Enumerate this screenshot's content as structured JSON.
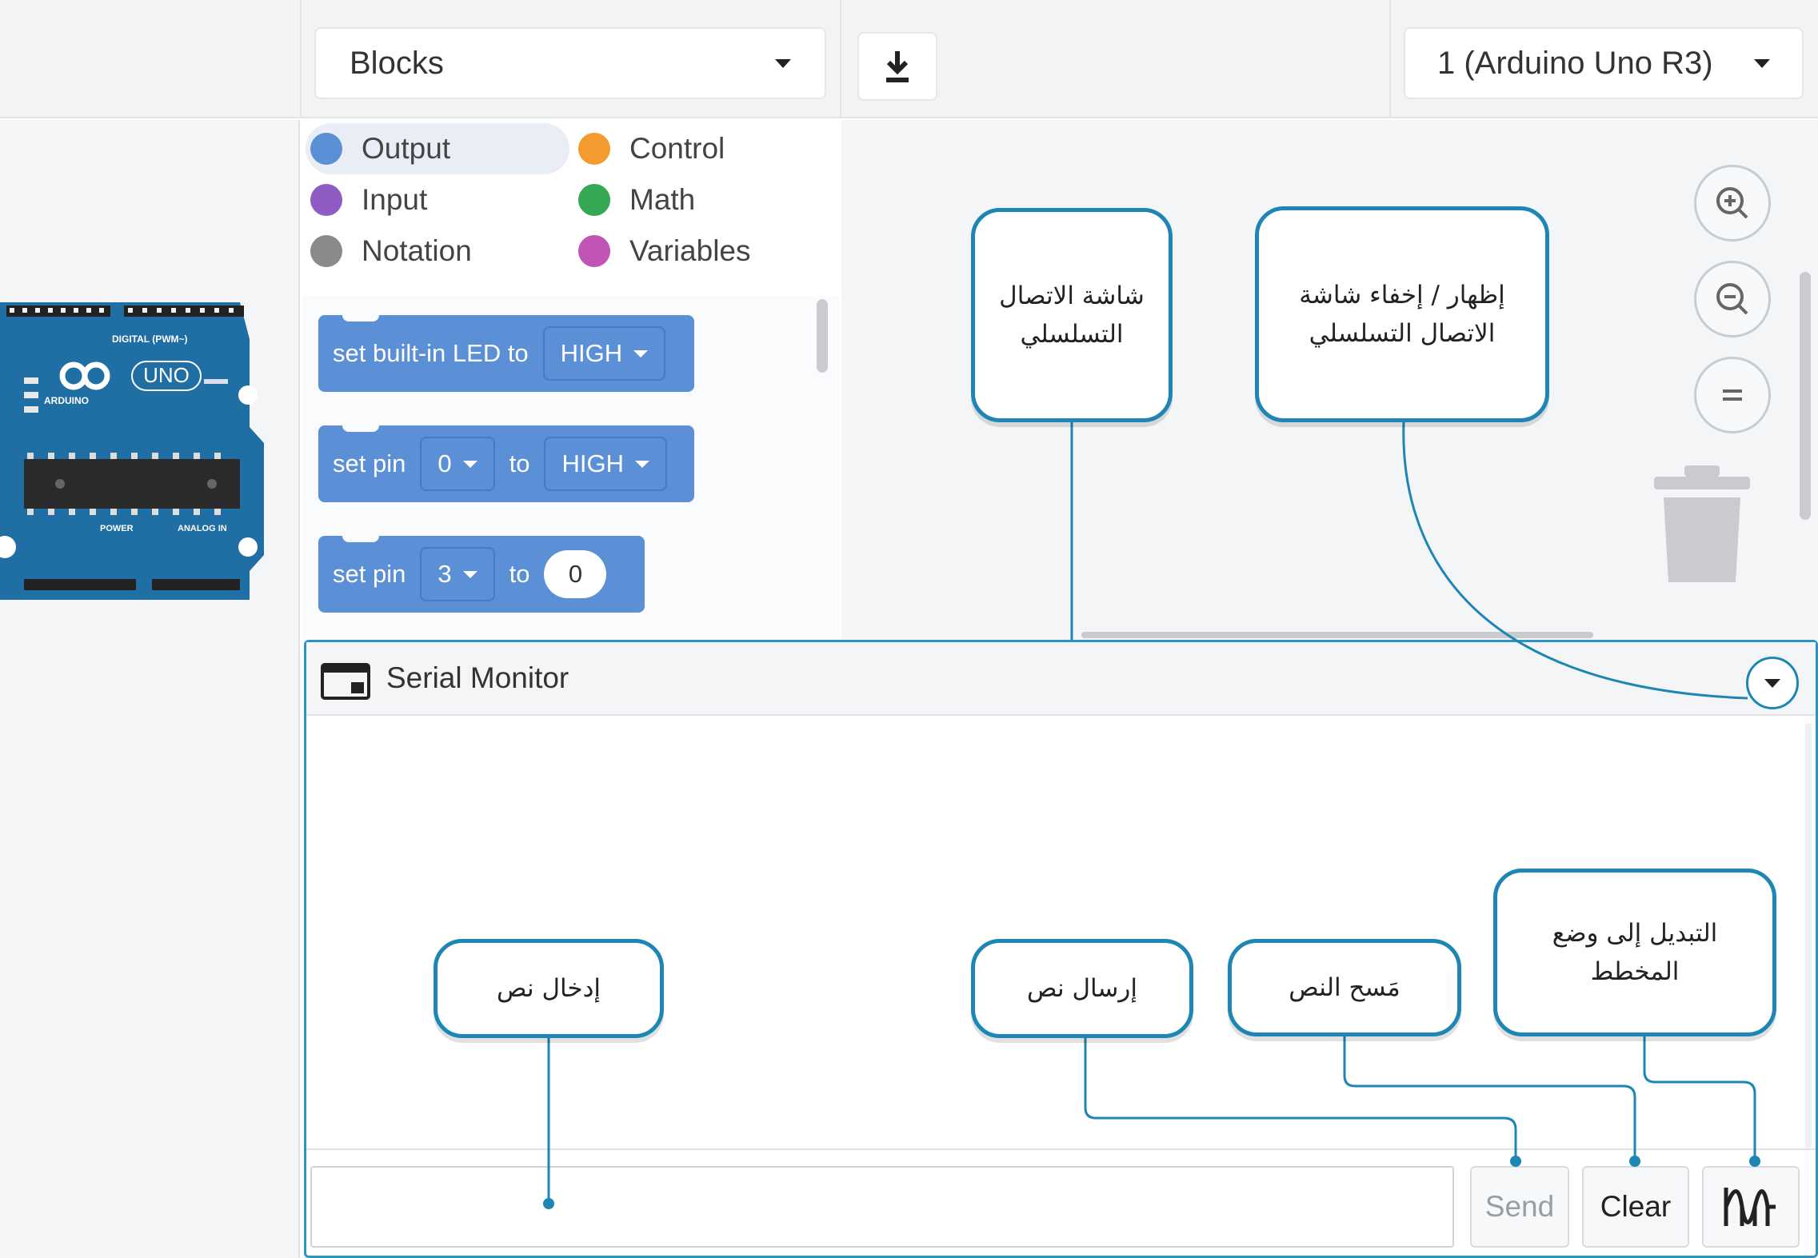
{
  "topbar": {
    "code_mode": "Blocks",
    "download_icon": "download-icon",
    "board_select": "1 (Arduino Uno R3)"
  },
  "categories": [
    {
      "label": "Output",
      "color": "#5b8fd6"
    },
    {
      "label": "Control",
      "color": "#f49b2f"
    },
    {
      "label": "Input",
      "color": "#8e5cc2"
    },
    {
      "label": "Math",
      "color": "#35a853"
    },
    {
      "label": "Notation",
      "color": "#8a8a8a"
    },
    {
      "label": "Variables",
      "color": "#c155b5"
    }
  ],
  "blocks": {
    "b1": {
      "text": "set built-in LED to",
      "value": "HIGH"
    },
    "b2": {
      "text1": "set pin",
      "pin": "0",
      "text2": "to",
      "value": "HIGH"
    },
    "b3": {
      "text1": "set pin",
      "pin": "3",
      "text2": "to",
      "value": "0"
    }
  },
  "board": {
    "logo": "ARDUINO",
    "model": "UNO",
    "labels": [
      "DIGITAL (PWM~)",
      "POWER",
      "ANALOG IN"
    ]
  },
  "serial_monitor": {
    "title": "Serial Monitor",
    "input_value": "",
    "send": "Send",
    "clear": "Clear"
  },
  "callouts": {
    "serial_screen": "شاشة الاتصال التسلسلي",
    "toggle_serial": "إظهار / إخفاء شاشة الاتصال التسلسلي",
    "enter_text": "إدخال نص",
    "send_text": "إرسال نص",
    "clear_text": "مَسح النص",
    "switch_plot": "التبديل إلى وضع المخطط"
  },
  "colors": {
    "accent": "#1d86b4",
    "block_blue": "#5b8fd6",
    "board_blue": "#1f6fa5"
  }
}
